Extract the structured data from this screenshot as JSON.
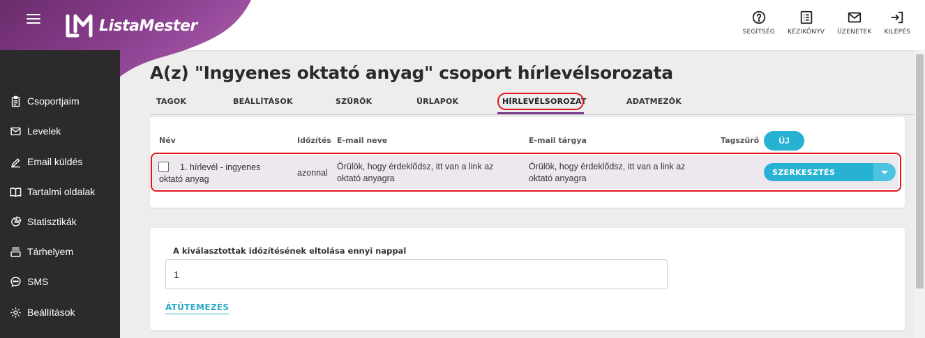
{
  "app": {
    "name": "ListaMester",
    "brand_colors": {
      "purple": "#7b3a8a",
      "accent": "#27b2d4",
      "highlight": "#e3141b"
    }
  },
  "top_actions": [
    {
      "icon": "help-circle-icon",
      "label": "SEGÍTSÉG"
    },
    {
      "icon": "manual-icon",
      "label": "KÉZIKÖNYV"
    },
    {
      "icon": "envelope-icon",
      "label": "ÜZENETEK"
    },
    {
      "icon": "logout-icon",
      "label": "KILÉPÉS"
    }
  ],
  "sidebar": {
    "items": [
      {
        "icon": "clipboard-icon",
        "label": "Csoportjaim"
      },
      {
        "icon": "envelope-icon",
        "label": "Levelek"
      },
      {
        "icon": "pen-icon",
        "label": "Email küldés"
      },
      {
        "icon": "book-icon",
        "label": "Tartalmi oldalak"
      },
      {
        "icon": "pie-chart-icon",
        "label": "Statisztikák"
      },
      {
        "icon": "storage-icon",
        "label": "Tárhelyem"
      },
      {
        "icon": "chat-icon",
        "label": "SMS"
      },
      {
        "icon": "gear-icon",
        "label": "Beállítások"
      }
    ]
  },
  "page": {
    "title": "A(z) \"Ingyenes oktató anyag\" csoport hírlevélsorozata"
  },
  "tabs": [
    {
      "label": "TAGOK"
    },
    {
      "label": "BEÁLLÍTÁSOK"
    },
    {
      "label": "SZŰRŐK"
    },
    {
      "label": "ŰRLAPOK"
    },
    {
      "label": "HÍRLEVÉLSOROZAT",
      "active": true
    },
    {
      "label": "ADATMEZŐK"
    }
  ],
  "table": {
    "headers": {
      "name": "Név",
      "timing": "Időzítés",
      "email_name": "E-mail neve",
      "email_subject": "E-mail tárgya",
      "tag_filter": "Tagszűrő"
    },
    "new_button": "ÚJ",
    "rows": [
      {
        "name_line1": "1. hírlevél - ingyenes",
        "name_line2": "oktató anyag",
        "timing": "azonnal",
        "email_name_line1": "Örülök, hogy érdeklődsz, itt van a link az",
        "email_name_line2": "oktató anyagra",
        "email_subject_line1": "Örülök, hogy érdeklődsz, itt van a link az",
        "email_subject_line2": "oktató anyagra",
        "edit_label": "SZERKESZTÉS"
      }
    ]
  },
  "shift_form": {
    "label": "A kiválasztottak időzítésének eltolása ennyi nappal",
    "value": "1",
    "submit_label": "ÁTÜTEMEZÉS"
  }
}
